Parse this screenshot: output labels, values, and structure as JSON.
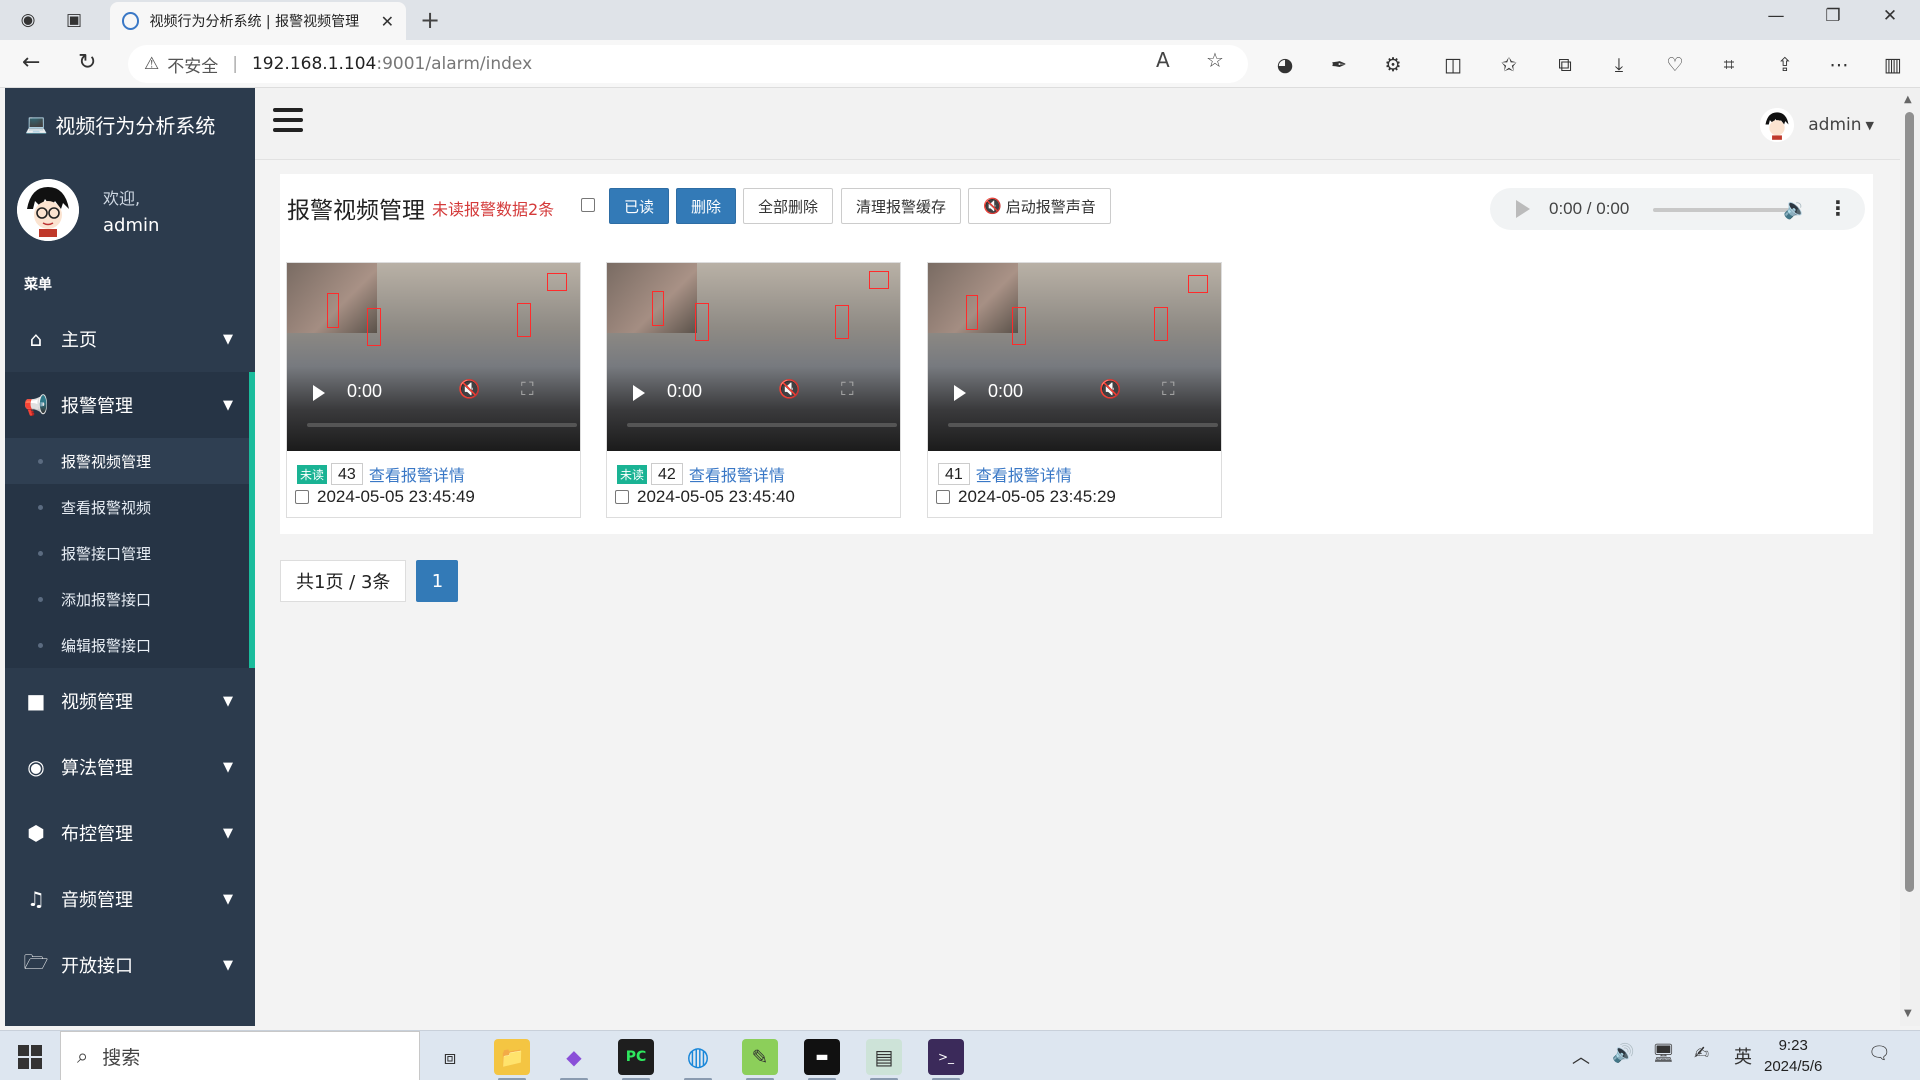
{
  "browser": {
    "tab_title": "视频行为分析系统 | 报警视频管理",
    "url_security": "不安全",
    "url_host": "192.168.1.104",
    "url_path": ":9001/alarm/index"
  },
  "sidebar": {
    "app_title": "视频行为分析系统",
    "welcome": "欢迎,",
    "username": "admin",
    "menu_label": "菜单",
    "items": [
      {
        "label": "主页",
        "icon": "home-icon"
      },
      {
        "label": "报警管理",
        "icon": "bullhorn-icon"
      },
      {
        "label": "视频管理",
        "icon": "video-camera-icon"
      },
      {
        "label": "算法管理",
        "icon": "eye-icon"
      },
      {
        "label": "布控管理",
        "icon": "cube-icon"
      },
      {
        "label": "音频管理",
        "icon": "music-icon"
      },
      {
        "label": "开放接口",
        "icon": "folder-open-icon"
      }
    ],
    "alarm_subitems": [
      "报警视频管理",
      "查看报警视频",
      "报警接口管理",
      "添加报警接口",
      "编辑报警接口"
    ]
  },
  "header": {
    "user": "admin"
  },
  "main": {
    "title": "报警视频管理",
    "unread_notice": "未读报警数据2条",
    "buttons": {
      "read": "已读",
      "delete": "删除",
      "delete_all": "全部删除",
      "clear_cache": "清理报警缓存",
      "enable_sound": "启动报警声音"
    },
    "audio_time": "0:00 / 0:00",
    "cards": [
      {
        "unread_badge": "未读",
        "id": "43",
        "link": "查看报警详情",
        "datetime": "2024-05-05 23:45:49",
        "video_time": "0:00"
      },
      {
        "unread_badge": "未读",
        "id": "42",
        "link": "查看报警详情",
        "datetime": "2024-05-05 23:45:40",
        "video_time": "0:00"
      },
      {
        "unread_badge": "",
        "id": "41",
        "link": "查看报警详情",
        "datetime": "2024-05-05 23:45:29",
        "video_time": "0:00"
      }
    ],
    "pagination": {
      "info": "共1页 / 3条",
      "current": "1"
    }
  },
  "taskbar": {
    "search_placeholder": "搜索",
    "ime": "英",
    "time": "9:23",
    "date": "2024/5/6"
  },
  "colors": {
    "sidebar_bg": "#2c3b4d",
    "primary": "#337ab7",
    "unread_red": "#d43a3a",
    "badge_green": "#1ab394",
    "accent_teal": "#1abc9c"
  }
}
